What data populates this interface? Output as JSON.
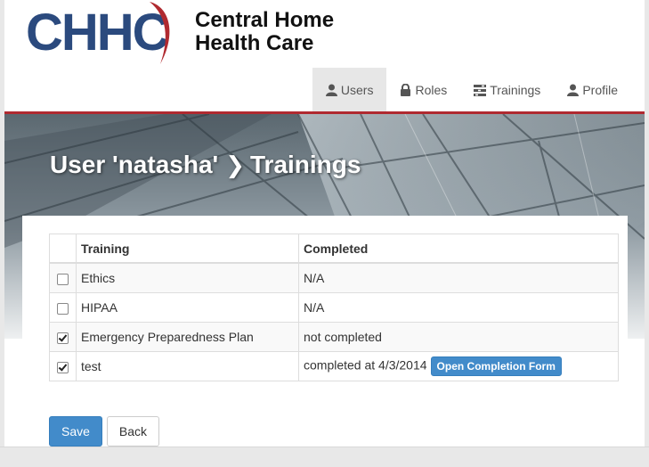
{
  "brand": {
    "mark": "CHHC",
    "name_line1": "Central Home",
    "name_line2": "Health Care",
    "colors": {
      "mark_blue": "#2b4a7e",
      "swoosh_red": "#b02a30"
    }
  },
  "nav": {
    "items": [
      {
        "label": "Users",
        "icon": "user-icon",
        "active": true
      },
      {
        "label": "Roles",
        "icon": "lock-icon",
        "active": false
      },
      {
        "label": "Trainings",
        "icon": "tasks-icon",
        "active": false
      },
      {
        "label": "Profile",
        "icon": "user-icon",
        "active": false
      }
    ]
  },
  "hero": {
    "title_user": "User 'natasha'",
    "separator_icon": "chevron-right-icon",
    "title_section": "Trainings"
  },
  "table": {
    "headers": [
      "",
      "Training",
      "Completed"
    ],
    "rows": [
      {
        "checked": false,
        "training": "Ethics",
        "completed": "N/A"
      },
      {
        "checked": false,
        "training": "HIPAA",
        "completed": "N/A"
      },
      {
        "checked": true,
        "training": "Emergency Preparedness Plan",
        "completed": "not completed"
      },
      {
        "checked": true,
        "training": "test",
        "completed": "completed at 4/3/2014",
        "action_label": "Open Completion Form"
      }
    ]
  },
  "actions": {
    "save_label": "Save",
    "back_label": "Back"
  }
}
